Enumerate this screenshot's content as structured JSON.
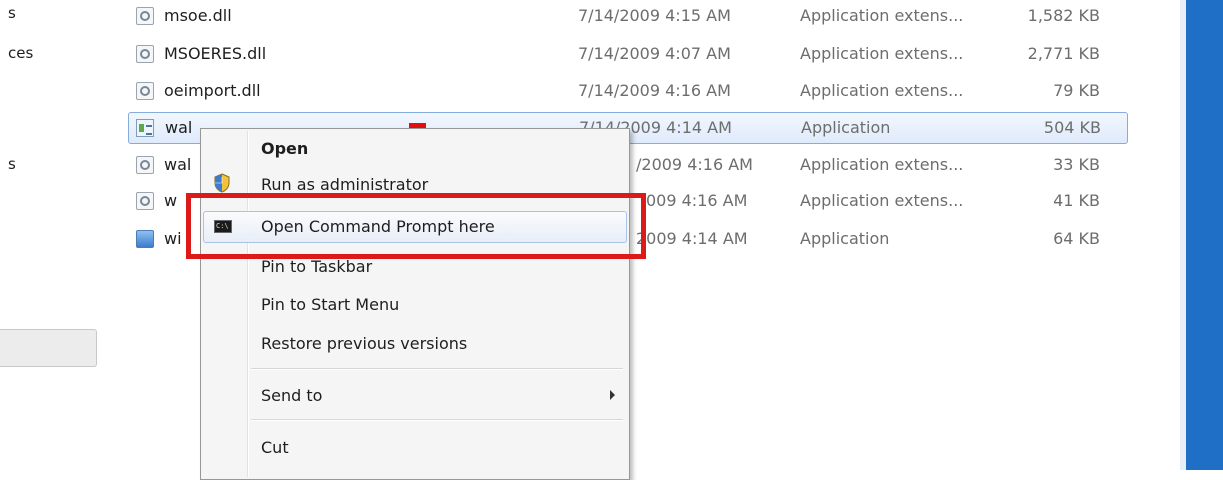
{
  "nav": {
    "items": [
      "s",
      "ces",
      "s"
    ]
  },
  "files": [
    {
      "name": "msoe.dll",
      "date": "7/14/2009 4:15 AM",
      "type": "Application extens...",
      "size": "1,582 KB",
      "icon": "dll-icon"
    },
    {
      "name": "MSOERES.dll",
      "date": "7/14/2009 4:07 AM",
      "type": "Application extens...",
      "size": "2,771 KB",
      "icon": "dll-icon"
    },
    {
      "name": "oeimport.dll",
      "date": "7/14/2009 4:16 AM",
      "type": "Application extens...",
      "size": "79 KB",
      "icon": "dll-icon"
    },
    {
      "name": "wal",
      "date": "7/14/2009 4:14 AM",
      "type": "Application",
      "size": "504 KB",
      "icon": "exe-icon"
    },
    {
      "name": "wal",
      "date": "/2009 4:16 AM",
      "type": "Application extens...",
      "size": "33 KB",
      "icon": "dll-icon"
    },
    {
      "name": "w",
      "date": "009 4:16 AM",
      "type": "Application extens...",
      "size": "41 KB",
      "icon": "dll-icon"
    },
    {
      "name": "wi",
      "date": "2009 4:14 AM",
      "type": "Application",
      "size": "64 KB",
      "icon": "app-icon"
    }
  ],
  "context_menu": {
    "open": "Open",
    "run_as_admin": "Run as administrator",
    "open_cmd_here": "Open Command Prompt here",
    "pin_taskbar": "Pin to Taskbar",
    "pin_start": "Pin to Start Menu",
    "restore_versions": "Restore previous versions",
    "send_to": "Send to",
    "cut": "Cut"
  },
  "colors": {
    "highlight_box": "#dc1a1a",
    "selection": "#dfeafb",
    "window_edge": "#1f6fc6"
  }
}
